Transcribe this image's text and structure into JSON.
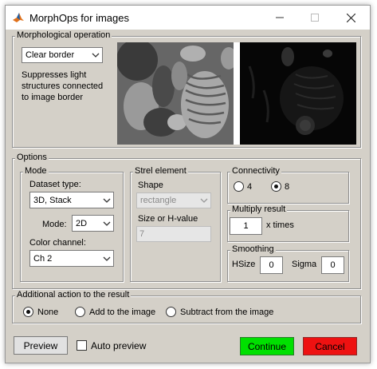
{
  "window": {
    "title": "MorphOps for images",
    "icon": "matlab-icon",
    "minimize_icon": "minimize-icon",
    "maximize_icon": "maximize-icon",
    "close_icon": "close-icon"
  },
  "morph": {
    "legend": "Morphological operation",
    "operation": {
      "value": "Clear border"
    },
    "description": [
      "Suppresses light",
      "structures connected",
      "to image border"
    ]
  },
  "options": {
    "legend": "Options",
    "mode": {
      "legend": "Mode",
      "dataset_label": "Dataset type:",
      "dataset_value": "3D, Stack",
      "mode_label": "Mode:",
      "mode_value": "2D",
      "color_label": "Color channel:",
      "color_value": "Ch 2"
    },
    "strel": {
      "legend": "Strel element",
      "shape_label": "Shape",
      "shape_value": "rectangle",
      "size_label": "Size or H-value",
      "size_value": "7"
    },
    "connectivity": {
      "legend": "Connectivity",
      "opt4": "4",
      "opt8": "8",
      "selected": "8"
    },
    "multiply": {
      "legend": "Multiply result",
      "value": "1",
      "suffix": "x times"
    },
    "smoothing": {
      "legend": "Smoothing",
      "hsize_label": "HSize",
      "hsize_value": "0",
      "sigma_label": "Sigma",
      "sigma_value": "0"
    }
  },
  "additional": {
    "legend": "Additional action to the result",
    "options": [
      "None",
      "Add to the image",
      "Subtract from the image"
    ],
    "selected": "None"
  },
  "footer": {
    "preview_label": "Preview",
    "auto_preview_label": "Auto preview",
    "auto_preview_checked": false,
    "continue_label": "Continue",
    "cancel_label": "Cancel"
  },
  "colors": {
    "dialog_bg": "#d4d0c8",
    "continue_bg": "#00e000",
    "cancel_bg": "#ee1111"
  }
}
